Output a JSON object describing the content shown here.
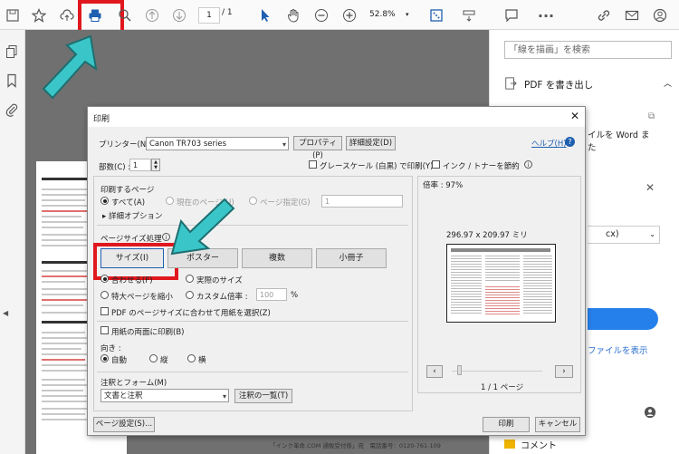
{
  "toolbar": {
    "page_current": "1",
    "page_total": "/ 1",
    "zoom": "52.8%"
  },
  "right_pane": {
    "search_placeholder": "「線を描画」を検索",
    "export_pdf": "PDF を書き出し",
    "convert_desc_a": "イルを Word ま",
    "convert_desc_b": "た",
    "format_select": "cx)",
    "show_files": "ファイルを表示",
    "comment": "コメント"
  },
  "document": {
    "footer": "「インク革命.COM 通販受付係」宛　電話番号：0120-761-109"
  },
  "dialog": {
    "title": "印刷",
    "printer_label": "プリンター(N) :",
    "printer_value": "Canon TR703 series",
    "properties_btn": "プロパティ(P)",
    "advanced_btn": "詳細設定(D)",
    "help_link": "ヘルプ(H)",
    "copies_label": "部数(C) :",
    "copies_value": "1",
    "grayscale_label": "グレースケール (白黒) で印刷(Y)",
    "save_ink_label": "インク / トナーを節約",
    "pages_section": "印刷するページ",
    "all_pages": "すべて(A)",
    "current_page": "現在のページ(U)",
    "page_range": "ページ指定(G)",
    "page_range_value": "1",
    "detail_options": "▸ 詳細オプション",
    "sizing_section": "ページサイズ処理",
    "tab_size": "サイズ(I)",
    "tab_poster": "ポスター",
    "tab_multiple": "複数",
    "tab_booklet": "小冊子",
    "fit": "合わせる(F)",
    "actual_size": "実際のサイズ",
    "shrink_oversized": "特大ページを縮小",
    "custom_scale": "カスタム倍率 :",
    "custom_scale_value": "100",
    "percent": "%",
    "choose_paper": "PDF のページサイズに合わせて用紙を選択(Z)",
    "duplex": "用紙の両面に印刷(B)",
    "orientation_label": "向き :",
    "auto": "自動",
    "portrait": "縦",
    "landscape": "横",
    "comments_section": "注釈とフォーム(M)",
    "comments_value": "文書と注釈",
    "summarize_btn": "注釈の一覧(T)",
    "scale_label": "倍率 : 97%",
    "paper_size": "296.97 x 209.97 ミリ",
    "page_indicator": "1 / 1 ページ",
    "page_setup_btn": "ページ設定(S)...",
    "print_btn": "印刷",
    "cancel_btn": "キャンセル"
  },
  "colors": {
    "highlight_red": "#e0181e",
    "arrow_teal": "#3ac6c8",
    "accent_blue": "#2680eb"
  }
}
